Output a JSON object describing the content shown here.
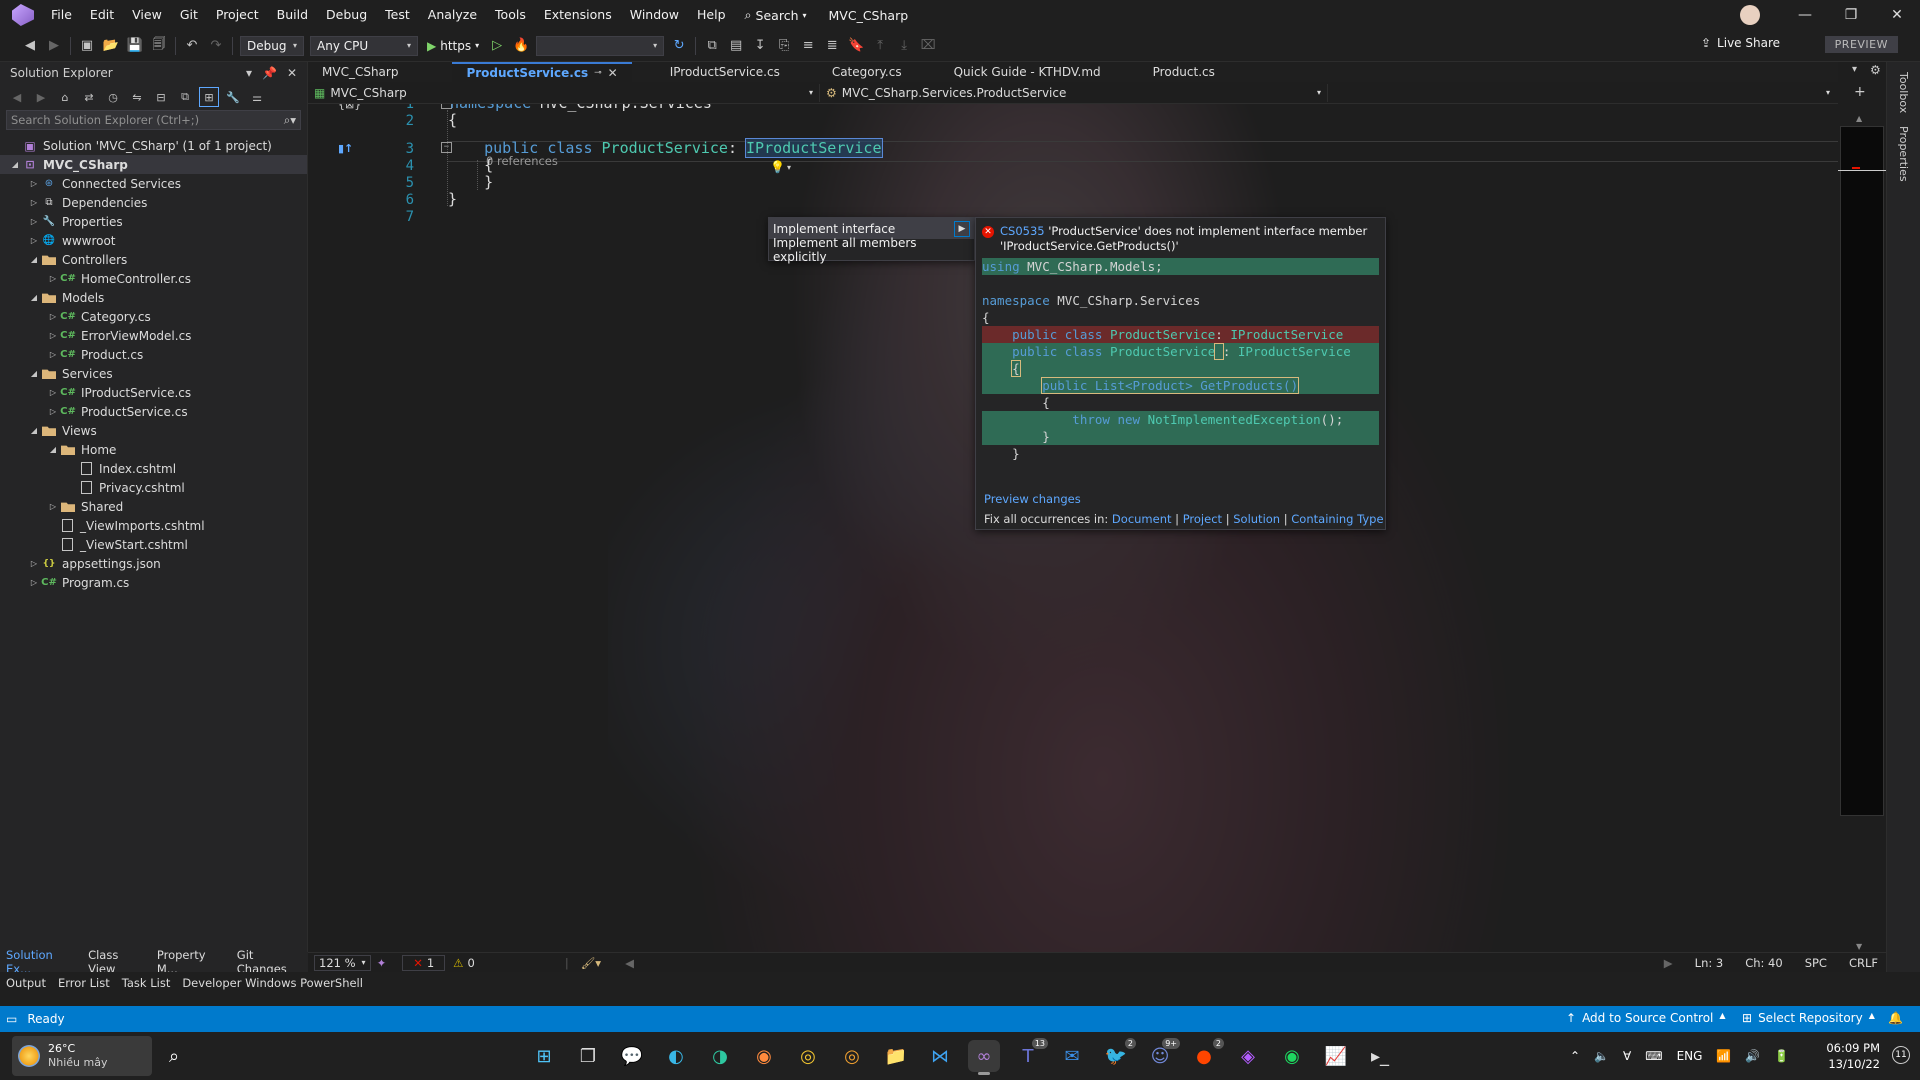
{
  "menubar": {
    "items": [
      "File",
      "Edit",
      "View",
      "Git",
      "Project",
      "Build",
      "Debug",
      "Test",
      "Analyze",
      "Tools",
      "Extensions",
      "Window",
      "Help"
    ],
    "search_label": "Search",
    "solution_title": "MVC_CSharp"
  },
  "toolbar": {
    "config": "Debug",
    "platform": "Any CPU",
    "run_label": "https",
    "live_share": "Live Share",
    "preview_badge": "PREVIEW"
  },
  "explorer": {
    "title": "Solution Explorer",
    "search_placeholder": "Search Solution Explorer (Ctrl+;)",
    "tree": [
      {
        "label": "Solution 'MVC_CSharp' (1 of 1 project)",
        "level": 0,
        "icon": "solution-icon",
        "expand": ""
      },
      {
        "label": "MVC_CSharp",
        "level": 0,
        "icon": "project-icon",
        "expand": "open",
        "selected": true,
        "bold": true
      },
      {
        "label": "Connected Services",
        "level": 1,
        "icon": "connected-services-icon",
        "expand": "closed"
      },
      {
        "label": "Dependencies",
        "level": 1,
        "icon": "dependencies-icon",
        "expand": "closed"
      },
      {
        "label": "Properties",
        "level": 1,
        "icon": "properties-icon",
        "expand": "closed"
      },
      {
        "label": "wwwroot",
        "level": 1,
        "icon": "globe-icon",
        "expand": "closed"
      },
      {
        "label": "Controllers",
        "level": 1,
        "icon": "folder-icon",
        "expand": "open"
      },
      {
        "label": "HomeController.cs",
        "level": 2,
        "icon": "csharp-file-icon",
        "expand": "closed"
      },
      {
        "label": "Models",
        "level": 1,
        "icon": "folder-icon",
        "expand": "open"
      },
      {
        "label": "Category.cs",
        "level": 2,
        "icon": "csharp-file-icon",
        "expand": "closed"
      },
      {
        "label": "ErrorViewModel.cs",
        "level": 2,
        "icon": "csharp-file-icon",
        "expand": "closed"
      },
      {
        "label": "Product.cs",
        "level": 2,
        "icon": "csharp-file-icon",
        "expand": "closed"
      },
      {
        "label": "Services",
        "level": 1,
        "icon": "folder-icon",
        "expand": "open"
      },
      {
        "label": "IProductService.cs",
        "level": 2,
        "icon": "csharp-file-icon",
        "expand": "closed"
      },
      {
        "label": "ProductService.cs",
        "level": 2,
        "icon": "csharp-file-icon",
        "expand": "closed"
      },
      {
        "label": "Views",
        "level": 1,
        "icon": "folder-icon",
        "expand": "open"
      },
      {
        "label": "Home",
        "level": 2,
        "icon": "folder-icon",
        "expand": "open"
      },
      {
        "label": "Index.cshtml",
        "level": 3,
        "icon": "razor-file-icon",
        "expand": ""
      },
      {
        "label": "Privacy.cshtml",
        "level": 3,
        "icon": "razor-file-icon",
        "expand": ""
      },
      {
        "label": "Shared",
        "level": 2,
        "icon": "folder-icon",
        "expand": "closed"
      },
      {
        "label": "_ViewImports.cshtml",
        "level": 2,
        "icon": "razor-file-icon",
        "expand": ""
      },
      {
        "label": "_ViewStart.cshtml",
        "level": 2,
        "icon": "razor-file-icon",
        "expand": ""
      },
      {
        "label": "appsettings.json",
        "level": 1,
        "icon": "json-file-icon",
        "expand": "closed"
      },
      {
        "label": "Program.cs",
        "level": 1,
        "icon": "csharp-file-icon",
        "expand": "closed"
      }
    ],
    "bottom_tabs": [
      "Solution Ex...",
      "Class View",
      "Property M...",
      "Git Changes"
    ]
  },
  "tabs": [
    {
      "label": "MVC_CSharp",
      "active": false
    },
    {
      "label": "ProductService.cs",
      "active": true
    },
    {
      "label": "IProductService.cs",
      "active": false
    },
    {
      "label": "Category.cs",
      "active": false
    },
    {
      "label": "Quick Guide - KTHDV.md",
      "active": false
    },
    {
      "label": "Product.cs",
      "active": false
    }
  ],
  "navbar": {
    "project": "MVC_CSharp",
    "type": "MVC_CSharp.Services.ProductService"
  },
  "editor": {
    "line_numbers": [
      "1",
      "2",
      "3",
      "4",
      "5",
      "6",
      "7"
    ],
    "references": "0 references",
    "lines": [
      [
        {
          "t": "namespace ",
          "c": "kw"
        },
        {
          "t": "MVC_CSharp.Services",
          "c": ""
        }
      ],
      [
        {
          "t": "{",
          "c": ""
        }
      ],
      [
        {
          "t": "    public class ",
          "c": "kw"
        },
        {
          "t": "ProductService",
          "c": "ty"
        },
        {
          "t": ": ",
          "c": ""
        },
        {
          "t": "IProductService",
          "c": "ty iface"
        }
      ],
      [
        {
          "t": "    {",
          "c": ""
        }
      ],
      [
        {
          "t": "    }",
          "c": ""
        }
      ],
      [
        {
          "t": "}",
          "c": ""
        }
      ],
      [
        {
          "t": "",
          "c": ""
        }
      ]
    ]
  },
  "quick_actions": {
    "items": [
      "Implement interface",
      "Implement all members explicitly"
    ]
  },
  "preview": {
    "error_code": "CS0535",
    "error_text": "'ProductService' does not implement interface member 'IProductService.GetProducts()'",
    "code": [
      {
        "type": "add",
        "segs": [
          {
            "t": "using ",
            "c": "kw"
          },
          {
            "t": "MVC_CSharp.Models;",
            "c": ""
          }
        ]
      },
      {
        "type": "gap",
        "segs": []
      },
      {
        "type": "",
        "segs": [
          {
            "t": "namespace ",
            "c": "kw"
          },
          {
            "t": "MVC_CSharp.Services",
            "c": ""
          }
        ]
      },
      {
        "type": "",
        "segs": [
          {
            "t": "{",
            "c": ""
          }
        ]
      },
      {
        "type": "del",
        "segs": [
          {
            "t": "    public class ",
            "c": "kw"
          },
          {
            "t": "ProductService",
            "c": "ty"
          },
          {
            "t": ": ",
            "c": ""
          },
          {
            "t": "IProductService",
            "c": "ty"
          }
        ]
      },
      {
        "type": "add",
        "segs": [
          {
            "t": "    public class ",
            "c": "kw"
          },
          {
            "t": "ProductService",
            "c": "ty"
          },
          {
            "t": " ",
            "c": "boxed"
          },
          {
            "t": ": ",
            "c": ""
          },
          {
            "t": "IProductService",
            "c": "ty"
          }
        ]
      },
      {
        "type": "add",
        "segs": [
          {
            "t": "    ",
            "c": ""
          },
          {
            "t": "{",
            "c": "boxed"
          }
        ]
      },
      {
        "type": "add",
        "segs": [
          {
            "t": "        ",
            "c": ""
          },
          {
            "t": "public List<Product> GetProducts()",
            "c": "boxed kwmix"
          }
        ]
      },
      {
        "type": "",
        "segs": [
          {
            "t": "        {",
            "c": ""
          }
        ]
      },
      {
        "type": "add",
        "segs": [
          {
            "t": "            throw new ",
            "c": "kw"
          },
          {
            "t": "NotImplementedException",
            "c": "ty"
          },
          {
            "t": "();",
            "c": ""
          }
        ]
      },
      {
        "type": "add",
        "segs": [
          {
            "t": "        }",
            "c": ""
          }
        ]
      },
      {
        "type": "",
        "segs": [
          {
            "t": "    }",
            "c": ""
          }
        ]
      }
    ],
    "preview_changes": "Preview changes",
    "fix_all_label": "Fix all occurrences in:",
    "fix_links": [
      "Document",
      "Project",
      "Solution",
      "Containing Type"
    ]
  },
  "side_tabs": [
    "Toolbox",
    "Properties"
  ],
  "editor_status": {
    "zoom": "121 %",
    "errors": "1",
    "warnings": "0",
    "ln": "Ln: 3",
    "ch": "Ch: 40",
    "spc": "SPC",
    "crlf": "CRLF"
  },
  "output_tabs": [
    "Output",
    "Error List",
    "Task List",
    "Developer Windows PowerShell"
  ],
  "statusbar": {
    "ready": "Ready",
    "source_control": "Add to Source Control",
    "repository": "Select Repository"
  },
  "taskbar": {
    "temperature": "26°C",
    "weather": "Nhiều mây",
    "language": "ENG",
    "time": "06:09 PM",
    "date": "13/10/22",
    "notifications": "11",
    "apps": [
      {
        "name": "start-icon",
        "badge": ""
      },
      {
        "name": "task-view-icon",
        "badge": ""
      },
      {
        "name": "teams-chat-icon",
        "badge": ""
      },
      {
        "name": "edge-icon",
        "badge": ""
      },
      {
        "name": "edge-dev-icon",
        "badge": ""
      },
      {
        "name": "firefox-icon",
        "badge": ""
      },
      {
        "name": "chrome-icon",
        "badge": ""
      },
      {
        "name": "chrome-canary-icon",
        "badge": ""
      },
      {
        "name": "file-explorer-icon",
        "badge": ""
      },
      {
        "name": "vscode-icon",
        "badge": ""
      },
      {
        "name": "visual-studio-icon",
        "badge": ""
      },
      {
        "name": "teams-icon",
        "badge": "13"
      },
      {
        "name": "mail-icon",
        "badge": ""
      },
      {
        "name": "twitter-icon",
        "badge": "2"
      },
      {
        "name": "discord-icon",
        "badge": "9+"
      },
      {
        "name": "reddit-icon",
        "badge": "2"
      },
      {
        "name": "messenger-icon",
        "badge": ""
      },
      {
        "name": "spotify-icon",
        "badge": ""
      },
      {
        "name": "resource-monitor-icon",
        "badge": ""
      },
      {
        "name": "terminal-icon",
        "badge": ""
      }
    ]
  }
}
